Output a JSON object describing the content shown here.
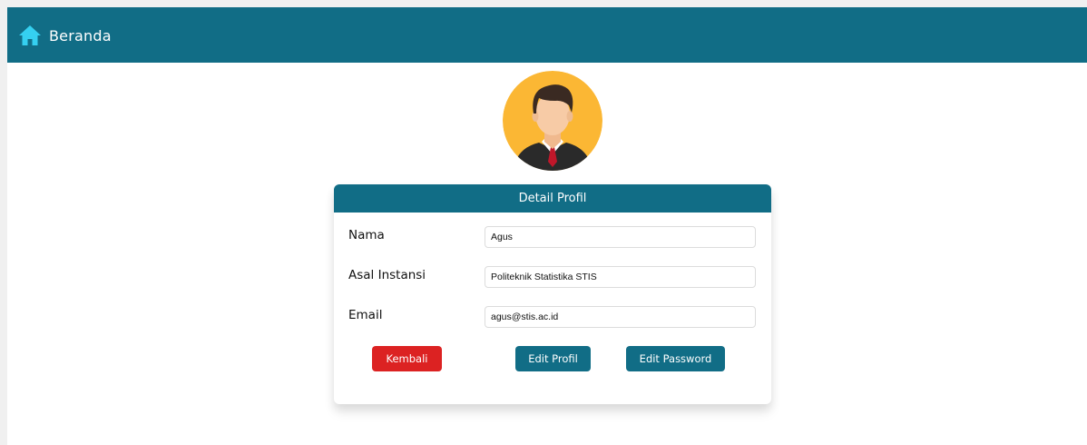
{
  "nav": {
    "home_label": "Beranda",
    "home_icon": "house-icon"
  },
  "avatar": {
    "icon": "user-avatar"
  },
  "card": {
    "title": "Detail Profil",
    "fields": [
      {
        "label": "Nama",
        "value": "Agus"
      },
      {
        "label": "Asal Instansi",
        "value": "Politeknik Statistika STIS"
      },
      {
        "label": "Email",
        "value": "agus@stis.ac.id"
      }
    ]
  },
  "buttons": {
    "back": "Kembali",
    "edit_profile": "Edit Profil",
    "edit_password": "Edit Password"
  },
  "colors": {
    "primary": "#116d86",
    "danger": "#dc2222",
    "home_icon": "#35d0f0",
    "avatar_bg": "#fbb734"
  }
}
